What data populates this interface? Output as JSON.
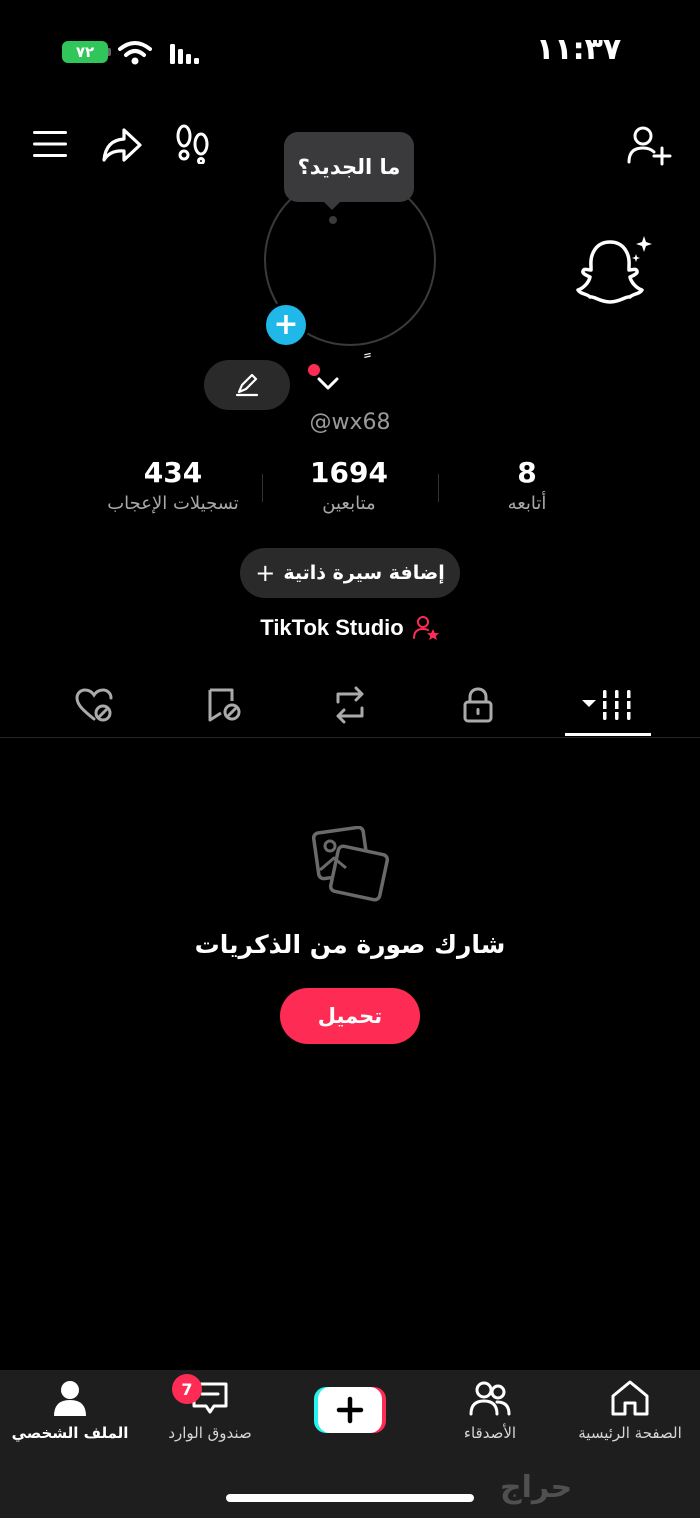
{
  "status_bar": {
    "time": "١١:٣٧",
    "battery": "٧٢"
  },
  "header": {
    "tooltip": "ما الجديد؟"
  },
  "profile": {
    "handle": "@wx68",
    "name_mark": "ً"
  },
  "stats": [
    {
      "value": "434",
      "label": "تسجيلات الإعجاب"
    },
    {
      "value": "1694",
      "label": "متابعين"
    },
    {
      "value": "8",
      "label": "أتابعه"
    }
  ],
  "bio_button": {
    "plus": "+",
    "label": "إضافة سيرة ذاتية"
  },
  "studio_link": {
    "label": "TikTok Studio"
  },
  "empty_state": {
    "title": "شارك صورة من الذكريات",
    "button": "تحميل"
  },
  "bottom_nav": {
    "profile": "الملف الشخصي",
    "inbox": "صندوق الوارد",
    "inbox_badge": "7",
    "friends": "الأصدقاء",
    "home": "الصفحة الرئيسية"
  },
  "watermark": "حراج",
  "colors": {
    "accent": "#fe2c55",
    "avatar_add": "#20b8e8",
    "battery": "#30c65a"
  }
}
